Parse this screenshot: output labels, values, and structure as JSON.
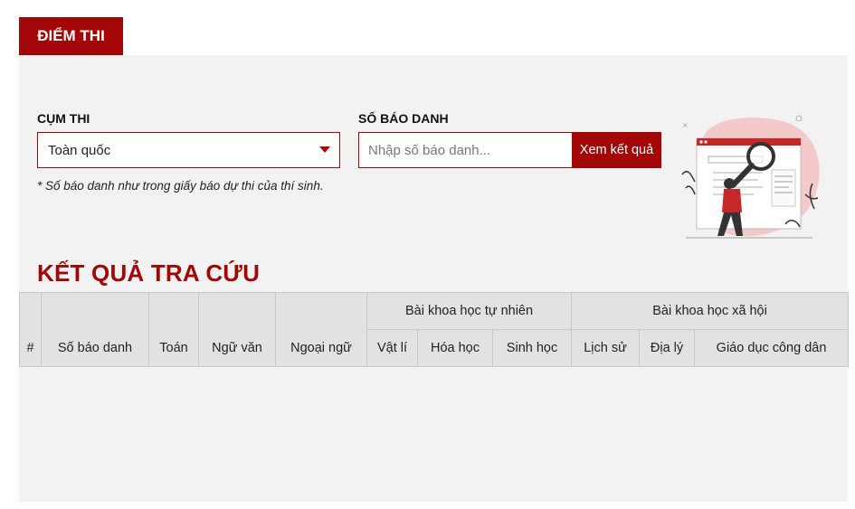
{
  "tab": {
    "label": "ĐIỂM THI"
  },
  "form": {
    "cluster_label": "CỤM THI",
    "cluster_value": "Toàn quốc",
    "id_label": "SỐ BÁO DANH",
    "id_placeholder": "Nhập số báo danh...",
    "id_value": "",
    "submit_label": "Xem kết quả",
    "note": "* Số báo danh như trong giấy báo dự thi của thí sinh."
  },
  "colors": {
    "brand": "#a20606",
    "panel": "#f2f2f2",
    "header": "#e2e2e2",
    "illustration_pink": "#f4c9c9"
  },
  "illustration": {
    "icon": "magnifier-search-illustration"
  },
  "results": {
    "title": "KẾT QUẢ TRA CỨU",
    "columns": {
      "index": "#",
      "candidate_id": "Số báo danh",
      "math": "Toán",
      "literature": "Ngữ văn",
      "foreign_language": "Ngoại ngữ",
      "natural_science": {
        "group": "Bài khoa học tự nhiên",
        "physics": "Vật lí",
        "chemistry": "Hóa học",
        "biology": "Sinh học"
      },
      "social_science": {
        "group": "Bài khoa học xã hội",
        "history": "Lịch sử",
        "geography": "Địa lý",
        "civics": "Giáo dục công dân"
      }
    },
    "rows": []
  }
}
